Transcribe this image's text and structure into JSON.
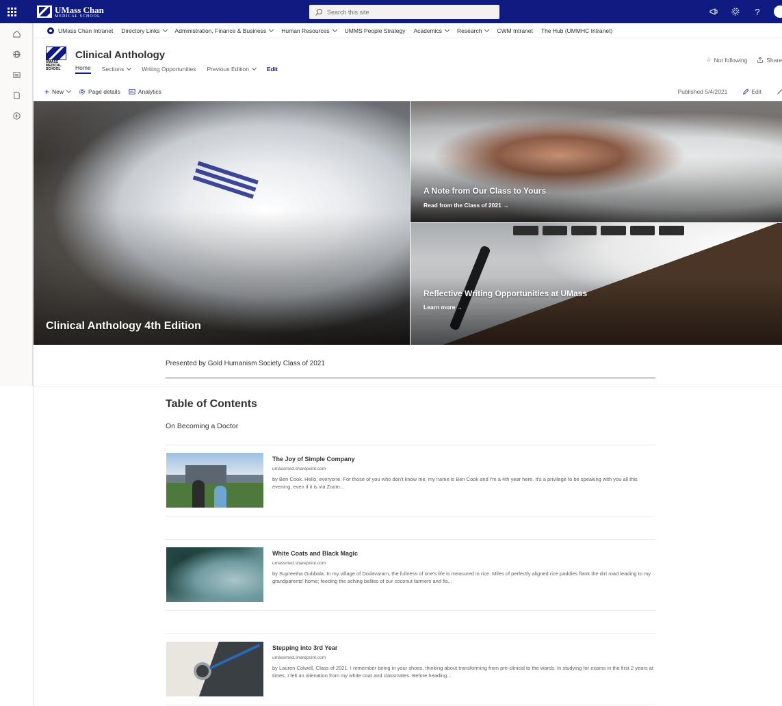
{
  "suitebar": {
    "brand_name": "UMass Chan",
    "brand_sub": "MEDICAL SCHOOL",
    "search_placeholder": "Search this site"
  },
  "hubnav": {
    "home": "UMass Chan Intranet",
    "items": [
      "Directory Links",
      "Administration, Finance & Business",
      "Human Resources",
      "UMMS People Strategy",
      "Academics",
      "Research",
      "CWM Intranet",
      "The Hub (UMMHC Intranet)"
    ]
  },
  "site": {
    "logo_text": "UMASS MEDICAL SCHOOL",
    "title": "Clinical Anthology",
    "nav": [
      "Home",
      "Sections",
      "Writing Opportunities",
      "Previous Edition",
      "Edit"
    ],
    "not_following": "Not following",
    "share": "Share"
  },
  "cmdbar": {
    "new": "New",
    "page_details": "Page details",
    "analytics": "Analytics",
    "published": "Published 5/4/2021",
    "edit": "Edit"
  },
  "hero": {
    "main_title": "Clinical Anthology 4th Edition",
    "tile2_title": "A Note from Our Class to Yours",
    "tile2_link": "Read from the Class of 2021 →",
    "tile3_title": "Reflective Writing Opportunities at UMass",
    "tile3_link": "Learn more →"
  },
  "presented": "Presented by Gold Humanism Society Class of 2021",
  "toc": {
    "title": "Table of Contents",
    "subtitle": "On Becoming a Doctor",
    "cards": [
      {
        "title": "The Joy of Simple Company",
        "domain": "umassmed.sharepoint.com",
        "desc": "by Ben Cook. Hello, everyone. For those of you who don't know me, my name is Ben Cook and I'm a 4th year here. It's a privilege to be speaking with you all this evening, even if it is via Zoom..."
      },
      {
        "title": "White Coats and Black Magic",
        "domain": "umassmed.sharepoint.com",
        "desc": "by Supreetha Gubbala. In my village of Dodavaram, the fullness of one's life is measured in rice. Miles of perfectly aligned rice paddies flank the dirt road leading to my grandparents' home; feeding the aching bellies of our coconut farmers and fis..."
      },
      {
        "title": "Stepping into 3rd Year",
        "domain": "umassmed.sharepoint.com",
        "desc": "by Lauren Colwell, Class of 2021. I remember being in your shoes, thinking about transforming from pre-clinical to the wards. In studying for exams in the first 2 years at times, I felt an alienation from my white coat and classmates. Before heading..."
      }
    ]
  }
}
